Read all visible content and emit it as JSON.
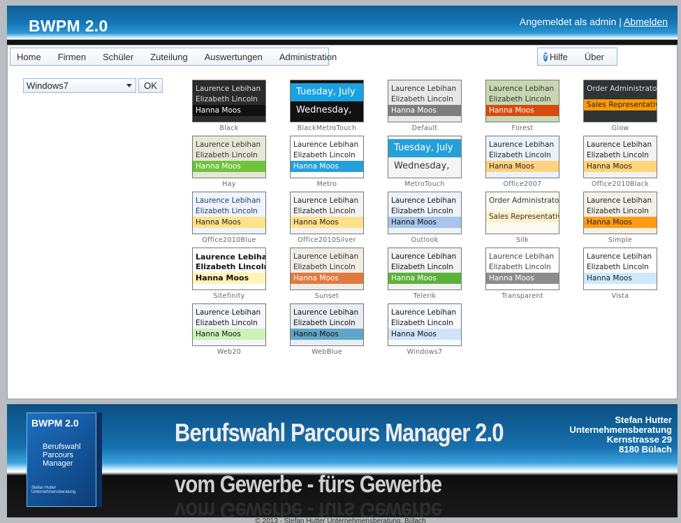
{
  "header": {
    "brand": "BWPM 2.0",
    "login_text": "Angemeldet als admin",
    "separator": "|",
    "logout": "Abmelden"
  },
  "menu": {
    "items": [
      "Home",
      "Firmen",
      "Schüler",
      "Zuteilung",
      "Auswertungen",
      "Administration"
    ],
    "help": "Hilfe",
    "about": "Über"
  },
  "skin_selector": {
    "selected": "Windows7",
    "ok_label": "OK"
  },
  "preview_names": [
    "Laurence Lebihan",
    "Elizabeth Lincoln",
    "Hanna Moos"
  ],
  "preview_alt": [
    "Order Administrator",
    "Sales Representative"
  ],
  "preview_metro": [
    "Tuesday, July",
    "Wednesday,"
  ],
  "skins": [
    {
      "name": "Black",
      "bg": "#2b2b2b",
      "fg": "#dddddd",
      "hi": "#111111",
      "hifg": "#ffffff",
      "kind": "names"
    },
    {
      "name": "BlackMetroTouch",
      "bg": "#111111",
      "fg": "#ffffff",
      "hi": "#1ba1e2",
      "kind": "metro-dark"
    },
    {
      "name": "Default",
      "bg": "#e8e8e8",
      "fg": "#333333",
      "hi": "#7d7d7d",
      "hifg": "#ffffff",
      "kind": "names"
    },
    {
      "name": "Forest",
      "bg": "#c8d7b2",
      "fg": "#333333",
      "hi": "#d84b0e",
      "hifg": "#ffffff",
      "kind": "names"
    },
    {
      "name": "Glow",
      "bg": "#2f3436",
      "fg": "#dddddd",
      "hi": "#ff9c00",
      "hifg": "#222222",
      "kind": "alt"
    },
    {
      "name": "Hay",
      "bg": "#e6e7d6",
      "fg": "#333333",
      "hi": "#6fc33a",
      "hifg": "#ffffff",
      "kind": "names"
    },
    {
      "name": "Metro",
      "bg": "#ffffff",
      "fg": "#222222",
      "hi": "#25a0da",
      "hifg": "#ffffff",
      "kind": "names"
    },
    {
      "name": "MetroTouch",
      "bg": "#f4f4f4",
      "fg": "#333333",
      "hi": "#25a0da",
      "kind": "metro-light"
    },
    {
      "name": "Office2007",
      "bg": "#eaf2fb",
      "fg": "#222222",
      "hi": "#ffd37e",
      "hifg": "#222222",
      "kind": "names"
    },
    {
      "name": "Office2010Black",
      "bg": "#f2f2f2",
      "fg": "#222222",
      "hi": "#ffd57a",
      "hifg": "#222222",
      "kind": "names"
    },
    {
      "name": "Office2010Blue",
      "bg": "#eef4fb",
      "fg": "#1e3a6b",
      "hi": "#ffe38a",
      "hifg": "#222222",
      "kind": "names"
    },
    {
      "name": "Office2010Silver",
      "bg": "#f3f3f3",
      "fg": "#222222",
      "hi": "#ffe08a",
      "hifg": "#222222",
      "kind": "names"
    },
    {
      "name": "Outlook",
      "bg": "#eef3fb",
      "fg": "#111111",
      "hi": "#a9c4ec",
      "hifg": "#111111",
      "kind": "names"
    },
    {
      "name": "Silk",
      "bg": "#fbfbf4",
      "fg": "#333333",
      "hi": "#fff1c8",
      "hifg": "#333333",
      "kind": "alt"
    },
    {
      "name": "Simple",
      "bg": "#f4f0e6",
      "fg": "#222222",
      "hi": "#ff9b16",
      "hifg": "#222222",
      "kind": "names"
    },
    {
      "name": "Sitefinity",
      "bg": "#ffffff",
      "fg": "#111111",
      "hi": "#fff3b6",
      "hifg": "#111111",
      "kind": "names-big"
    },
    {
      "name": "Sunset",
      "bg": "#f1ece6",
      "fg": "#333333",
      "hi": "#e07a3f",
      "hifg": "#ffffff",
      "kind": "names"
    },
    {
      "name": "Telerik",
      "bg": "#f2f2f2",
      "fg": "#111111",
      "hi": "#5bb23a",
      "hifg": "#ffffff",
      "kind": "names"
    },
    {
      "name": "Transparent",
      "bg": "#ffffff",
      "fg": "#444444",
      "hi": "#8c8c8c",
      "hifg": "#ffffff",
      "kind": "names"
    },
    {
      "name": "Vista",
      "bg": "#ffffff",
      "fg": "#222222",
      "hi": "#cdeafc",
      "hifg": "#222222",
      "kind": "names"
    },
    {
      "name": "Web20",
      "bg": "#f4f6fb",
      "fg": "#111111",
      "hi": "#ccf2b8",
      "hifg": "#111111",
      "kind": "names"
    },
    {
      "name": "WebBlue",
      "bg": "#e8edf3",
      "fg": "#111111",
      "hi": "#5fa6c9",
      "hifg": "#111111",
      "kind": "names"
    },
    {
      "name": "Windows7",
      "bg": "#f6f9fd",
      "fg": "#111111",
      "hi": "#cfe3fb",
      "hifg": "#111111",
      "kind": "names"
    }
  ],
  "banner": {
    "box_title": "BWPM 2.0",
    "box_subtitle": [
      "Berufswahl",
      "Parcours",
      "Manager"
    ],
    "box_footer": "Stefan Hutter Unternehmensberatung",
    "headline": "Berufswahl Parcours Manager 2.0",
    "slogan": "vom Gewerbe - fürs Gewerbe",
    "address": [
      "Stefan Hutter",
      "Unternehmensberatung",
      "Kernstrasse 29",
      "8180 Bülach"
    ]
  },
  "copyright": "© 2013 - Stefan Hutter Unternehmensberatung, Bülach"
}
